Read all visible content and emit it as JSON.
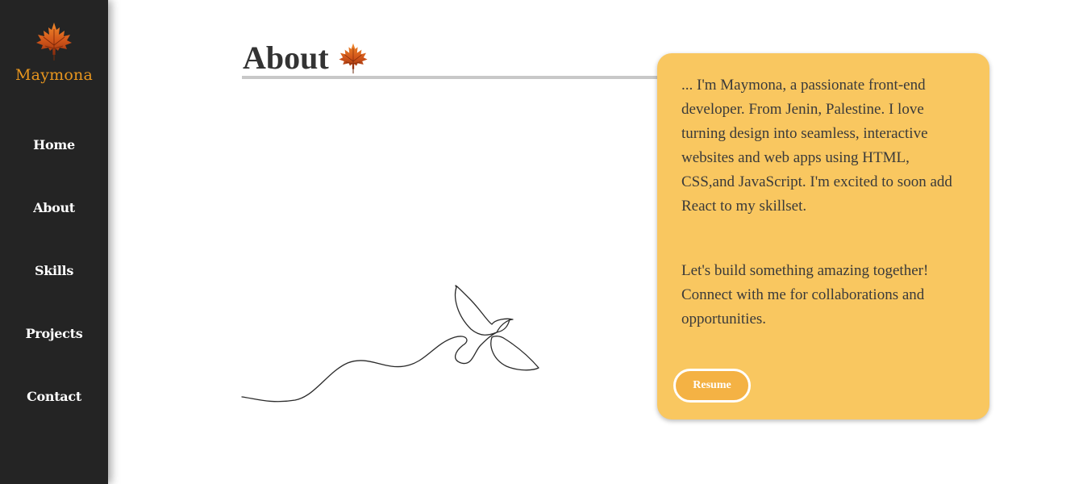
{
  "brand": {
    "name": "Maymona",
    "logo_icon": "maple-leaf-icon",
    "name_color": "#e8961e"
  },
  "nav": {
    "items": [
      {
        "label": "Home"
      },
      {
        "label": "About"
      },
      {
        "label": "Skills"
      },
      {
        "label": "Projects"
      },
      {
        "label": "Contact"
      }
    ]
  },
  "section": {
    "title": "About",
    "title_icon": "maple-leaf-icon",
    "illustration": "bird-line-art"
  },
  "card": {
    "paragraph_1": "... I'm Maymona, a passionate front-end developer. From Jenin, Palestine. I love turning design into seamless, interactive websites and web apps using HTML, CSS,and JavaScript. I'm excited to soon add React to my skillset.",
    "paragraph_2": "Let's build something amazing together! Connect with me for collaborations and opportunities.",
    "resume_label": "Resume",
    "background": "#f9c760",
    "button_color": "#f4b244"
  },
  "colors": {
    "sidebar": "#242424",
    "text": "#333333"
  }
}
